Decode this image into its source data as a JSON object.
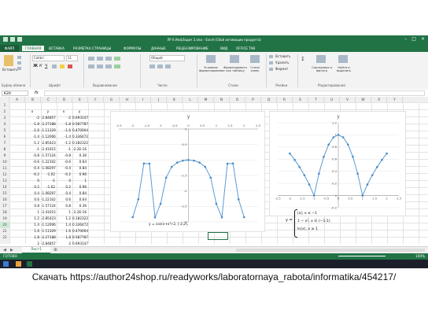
{
  "window": {
    "title": "ЛР 6 ИнфЗадач 3.xlsx - Excel (Сбой активации продукта)"
  },
  "ribbon_tabs": [
    "ФАЙЛ",
    "ГЛАВНАЯ",
    "ВСТАВКА",
    "РАЗМЕТКА СТРАНИЦЫ",
    "ФОРМУЛЫ",
    "ДАННЫЕ",
    "РЕЦЕНЗИРОВАНИЕ",
    "ВИД",
    "OFFICE TAB"
  ],
  "ribbon": {
    "paste": "Вставить",
    "font_name": "Calibri",
    "font_size": "11",
    "number_format": "Общий",
    "cond_format": "Условное форматирование",
    "format_table": "Форматировать как таблицу",
    "cell_styles": "Стили ячеек",
    "insert": "Вставить",
    "delete": "Удалить",
    "format": "Формат",
    "sort": "Сортировка и фильтр",
    "find": "Найти и выделить",
    "groups": {
      "clipboard": "Буфер обмена",
      "font": "Шрифт",
      "align": "Выравнивание",
      "number": "Число",
      "styles": "Стили",
      "cells": "Ячейки",
      "editing": "Редактирование"
    }
  },
  "formula_bar": {
    "name_box": "K20",
    "fx": "fx",
    "value": ""
  },
  "columns": [
    "A",
    "B",
    "C",
    "D",
    "E",
    "F",
    "G",
    "H",
    "I",
    "J",
    "K",
    "L",
    "M",
    "N",
    "O",
    "P",
    "Q",
    "R",
    "S",
    "T",
    "U",
    "V",
    "W",
    "X",
    "Y"
  ],
  "rows": [
    "1",
    "2",
    "3",
    "4",
    "5",
    "6",
    "7",
    "8",
    "9",
    "10",
    "11",
    "12",
    "13",
    "14",
    "15",
    "16",
    "17",
    "18",
    "19",
    "20",
    "21",
    "22"
  ],
  "selected_row": "20",
  "table": [
    [
      "x",
      "y",
      "x",
      "y"
    ],
    [
      "-2",
      "-2.84857",
      "-2",
      "0.693147"
    ],
    [
      "-1.8",
      "-2.27188",
      "-1.8",
      "0.587787"
    ],
    [
      "-1.6",
      "-1.11329",
      "-1.6",
      "0.470004"
    ],
    [
      "-1.4",
      "-1.12006",
      "-1.4",
      "0.336472"
    ],
    [
      "-1.2",
      "-2.85423",
      "-1.2",
      "0.182322"
    ],
    [
      "-1",
      "-2.41615",
      "-1",
      "-2.2E-16"
    ],
    [
      "-0.8",
      "-1.57124",
      "-0.8",
      "0.36"
    ],
    [
      "-0.6",
      "-1.22102",
      "-0.6",
      "0.64"
    ],
    [
      "-0.4",
      "-1.08297",
      "-0.4",
      "0.84"
    ],
    [
      "-0.2",
      "-1.02",
      "-0.2",
      "0.96"
    ],
    [
      "0",
      "-1",
      "0",
      "1"
    ],
    [
      "0.2",
      "-1.02",
      "0.2",
      "0.96"
    ],
    [
      "0.4",
      "-1.08297",
      "0.4",
      "0.84"
    ],
    [
      "0.6",
      "-1.22102",
      "0.6",
      "0.64"
    ],
    [
      "0.8",
      "-1.57124",
      "0.8",
      "0.36"
    ],
    [
      "1",
      "-2.41615",
      "1",
      "-2.2E-16"
    ],
    [
      "1.2",
      "-2.85423",
      "1.2",
      "0.182322"
    ],
    [
      "1.4",
      "-1.12006",
      "1.4",
      "0.336472"
    ],
    [
      "1.6",
      "-1.11329",
      "1.6",
      "0.470004"
    ],
    [
      "1.8",
      "-2.27188",
      "1.8",
      "0.587787"
    ],
    [
      "2",
      "-2.84857",
      "2",
      "0.693147"
    ]
  ],
  "formula_note": "y = cos(x+x²)-2, [-2;2],",
  "piecewise": [
    "|x|; x ≤ −1",
    "1 − x², x ∈ (−1;1)",
    "ln(x), x ≥ 1"
  ],
  "piecewise_lhs": "y =",
  "sheet_tab": "Лист1",
  "status": {
    "ready": "ГОТОВО",
    "zoom": "100%"
  },
  "footer_text": "Скачать https://author24shop.ru/readyworks/laboratornaya_rabota/informatika/454217/",
  "chart_data": [
    {
      "type": "line",
      "title": "y",
      "x": [
        -2,
        -1.8,
        -1.6,
        -1.4,
        -1.2,
        -1,
        -0.8,
        -0.6,
        -0.4,
        -0.2,
        0,
        0.2,
        0.4,
        0.6,
        0.8,
        1,
        1.2,
        1.4,
        1.6,
        1.8,
        2
      ],
      "series": [
        {
          "values": [
            -2.84857,
            -2.27188,
            -1.11329,
            -1.12006,
            -2.85423,
            -2.41615,
            -1.57124,
            -1.22102,
            -1.08297,
            -1.02,
            -1,
            -1.02,
            -1.08297,
            -1.22102,
            -1.57124,
            -2.41615,
            -2.85423,
            -1.12006,
            -1.11329,
            -2.27188,
            -2.84857
          ]
        }
      ],
      "xlim": [
        -2.5,
        2.5
      ],
      "ylim": [
        -3,
        0
      ],
      "xticks": [
        "-2.5",
        "-2",
        "-1.5",
        "-1",
        "-0.5",
        "0",
        "0.5",
        "1",
        "1.5",
        "2",
        "2.5"
      ],
      "yticks": [
        "0",
        "-0.5",
        "-1",
        "-1.5",
        "-2",
        "-2.5",
        "-3"
      ]
    },
    {
      "type": "line",
      "title": "y",
      "x": [
        -2,
        -1.8,
        -1.6,
        -1.4,
        -1.2,
        -1,
        -0.8,
        -0.6,
        -0.4,
        -0.2,
        0,
        0.2,
        0.4,
        0.6,
        0.8,
        1,
        1.2,
        1.4,
        1.6,
        1.8,
        2
      ],
      "series": [
        {
          "values": [
            0.693147,
            0.587787,
            0.470004,
            0.336472,
            0.182322,
            0,
            0.36,
            0.64,
            0.84,
            0.96,
            1,
            0.96,
            0.84,
            0.64,
            0.36,
            0,
            0.182322,
            0.336472,
            0.470004,
            0.587787,
            0.693147
          ]
        }
      ],
      "xlim": [
        -2.5,
        2.5
      ],
      "ylim": [
        -0.2,
        1.2
      ],
      "xticks": [
        "-2.5",
        "-2",
        "-1.5",
        "-1",
        "-0.5",
        "0",
        "0.5",
        "1",
        "1.5",
        "2",
        "2.5"
      ],
      "yticks": [
        "1.2",
        "1",
        "0.8",
        "0.6",
        "0.4",
        "0.2",
        "0",
        "-0.2"
      ]
    }
  ]
}
